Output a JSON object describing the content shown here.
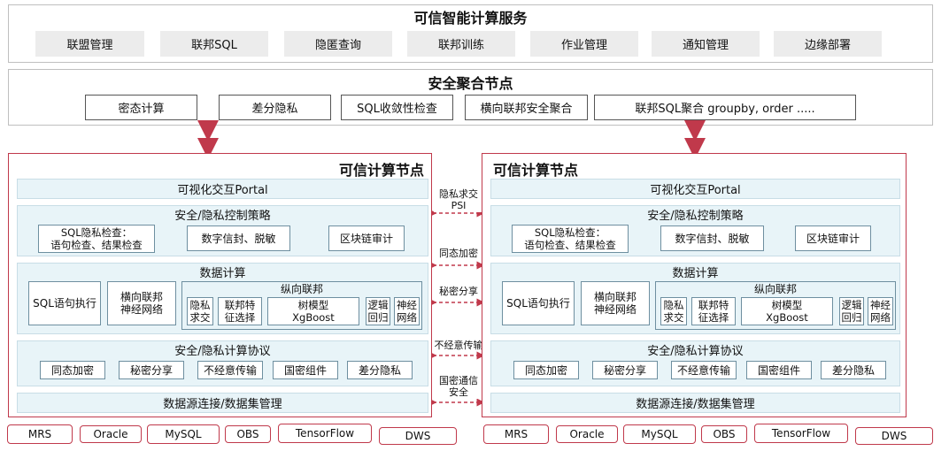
{
  "service": {
    "title": "可信智能计算服务",
    "items": [
      "联盟管理",
      "联邦SQL",
      "隐匿查询",
      "联邦训练",
      "作业管理",
      "通知管理",
      "边缘部署"
    ]
  },
  "aggregation": {
    "title": "安全聚合节点",
    "items": [
      "密态计算",
      "差分隐私",
      "SQL收敛性检查",
      "横向联邦安全聚合",
      "联邦SQL聚合 groupby, order ....."
    ]
  },
  "node": {
    "title": "可信计算节点",
    "portal": "可视化交互Portal",
    "policy": {
      "title": "安全/隐私控制策略",
      "sql_check_line1": "SQL隐私检查：",
      "sql_check_line2": "语句检查、结果检查",
      "sign": "数字信封、脱敏",
      "audit": "区块链审计"
    },
    "compute": {
      "title": "数据计算",
      "sql_exec": "SQL语句执行",
      "hfl_line1": "横向联邦",
      "hfl_line2": "神经网络",
      "vertical": {
        "title": "纵向联邦",
        "psi_line1": "隐私",
        "psi_line2": "求交",
        "feat_line1": "联邦特",
        "feat_line2": "征选择",
        "tree_line1": "树模型",
        "tree_line2": "XgBoost",
        "lr_line1": "逻辑",
        "lr_line2": "回归",
        "nn_line1": "神经",
        "nn_line2": "网络"
      }
    },
    "protocol": {
      "title": "安全/隐私计算协议",
      "items": [
        "同态加密",
        "秘密分享",
        "不经意传输",
        "国密组件",
        "差分隐私"
      ]
    },
    "datasource": "数据源连接/数据集管理"
  },
  "links": {
    "psi_line1": "隐私求交",
    "psi_line2": "PSI",
    "he": "同态加密",
    "ss": "秘密分享",
    "ot": "不经意传输",
    "gm_line1": "国密通信",
    "gm_line2": "安全"
  },
  "datasources": [
    "MRS",
    "Oracle",
    "MySQL",
    "OBS",
    "TensorFlow",
    "DWS"
  ],
  "colors": {
    "node_border": "#c0394b",
    "band": "#e8f4f8",
    "arrow": "#c0394b"
  }
}
